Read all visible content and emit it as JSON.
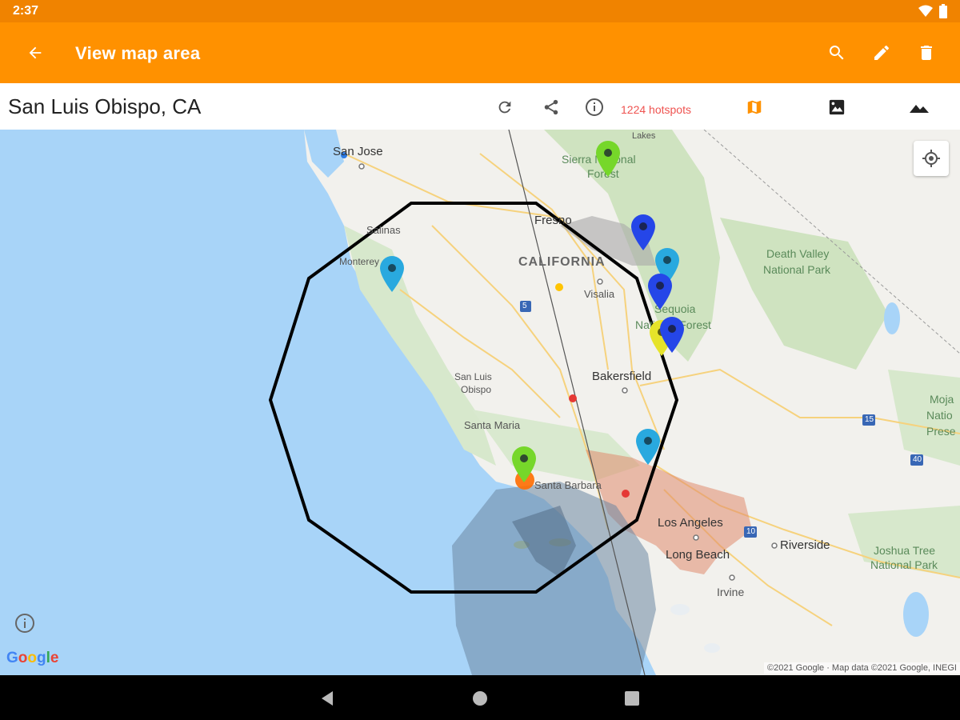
{
  "status_bar": {
    "time": "2:37",
    "icons": [
      "wifi-icon",
      "battery-icon"
    ]
  },
  "app_bar": {
    "title": "View map area",
    "background": "#ff9100",
    "actions": [
      "search-icon",
      "edit-icon",
      "delete-icon"
    ]
  },
  "toolbar": {
    "location": "San Luis Obispo, CA",
    "hotspots": "1224 hotspots",
    "hotspots_color": "#ef5350",
    "icons": [
      "refresh-icon",
      "share-icon",
      "info-icon",
      "map-type-icon",
      "satellite-icon",
      "terrain-icon"
    ],
    "selected_map_type": "map"
  },
  "map": {
    "labels": {
      "san_jose": "San Jose",
      "sierra_forest_1": "Sierra National",
      "sierra_forest_2": "Forest",
      "lakes": "Lakes",
      "fresno": "Fresno",
      "salinas": "Salinas",
      "monterey": "Monterey",
      "california": "CALIFORNIA",
      "visalia": "Visalia",
      "death_valley_1": "Death Valley",
      "death_valley_2": "National Park",
      "sequoia_1": "Sequoia",
      "sequoia_2": "National Forest",
      "bakersfield": "Bakersfield",
      "san_luis_1": "San Luis",
      "san_luis_2": "Obispo",
      "santa_maria": "Santa Maria",
      "santa_barbara": "Santa Barbara",
      "los_angeles": "Los Angeles",
      "long_beach": "Long Beach",
      "riverside": "Riverside",
      "irvine": "Irvine",
      "joshua_1": "Joshua Tree",
      "joshua_2": "National Park",
      "mojave_1": "Moja",
      "mojave_2": "Natio",
      "mojave_3": "Prese",
      "i15": "15",
      "i40": "40",
      "i10": "10",
      "i5": "5"
    },
    "pins": [
      {
        "id": "pin-green-sierra",
        "color": "#76d72a"
      },
      {
        "id": "pin-blue-1",
        "color": "#2546e8"
      },
      {
        "id": "pin-lightblue-1",
        "color": "#29a9df"
      },
      {
        "id": "pin-blue-2",
        "color": "#2546e8"
      },
      {
        "id": "pin-yellow",
        "color": "#e6e32a"
      },
      {
        "id": "pin-blue-3",
        "color": "#2546e8"
      },
      {
        "id": "pin-lightblue-monterey",
        "color": "#29a9df"
      },
      {
        "id": "pin-lightblue-2",
        "color": "#29a9df"
      },
      {
        "id": "pin-green-santa-barbara",
        "color": "#76d72a"
      }
    ],
    "attribution": "©2021 Google · Map data ©2021 Google, INEGI",
    "logo": "Google"
  },
  "nav_bar": {
    "icons": [
      "back-triangle-icon",
      "home-circle-icon",
      "recents-square-icon"
    ]
  }
}
